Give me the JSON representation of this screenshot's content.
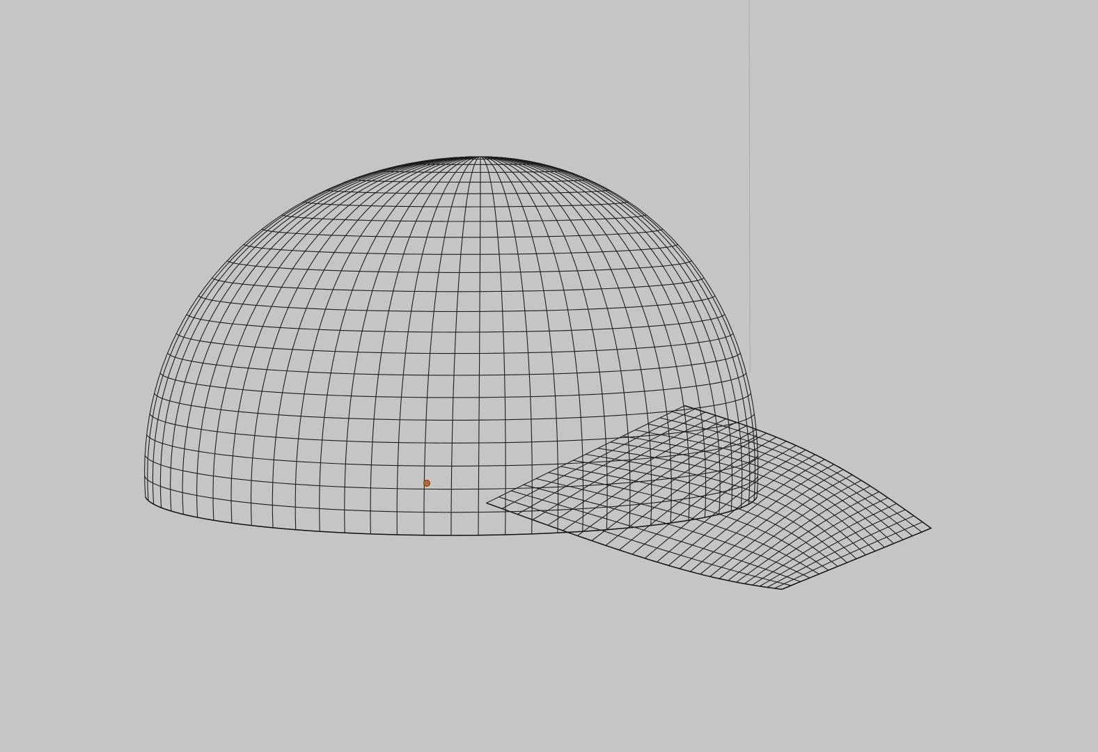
{
  "viewport": {
    "background_color": "#c5c5c5",
    "wire_color": "#1c1c1c",
    "origin_color": "#c8641e"
  },
  "object": {
    "type": "wireframe-mesh",
    "subject": "baseball cap",
    "shading": "wireframe"
  }
}
